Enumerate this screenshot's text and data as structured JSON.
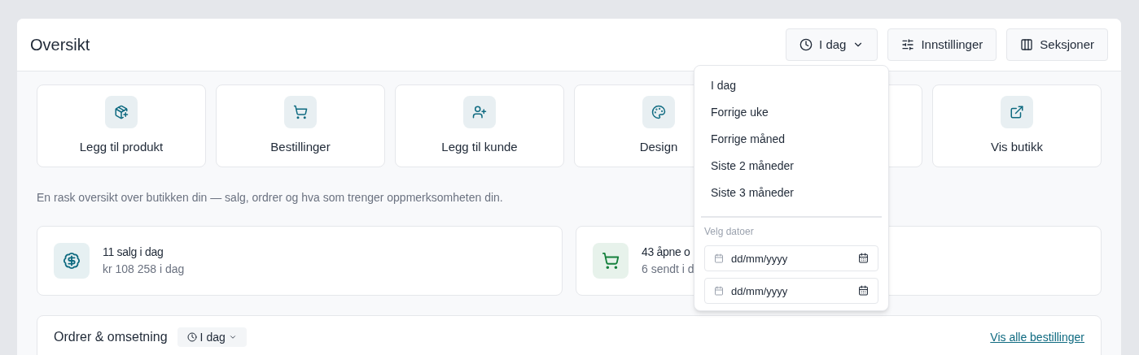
{
  "header": {
    "title": "Oversikt",
    "buttons": [
      {
        "kind": "period",
        "label": "I dag"
      },
      {
        "kind": "settings",
        "label": "Innstillinger"
      },
      {
        "kind": "sections",
        "label": "Seksjoner"
      }
    ]
  },
  "quick_actions": [
    {
      "kind": "product",
      "label": "Legg til produkt"
    },
    {
      "kind": "orders",
      "label": "Bestillinger"
    },
    {
      "kind": "customer",
      "label": "Legg til kunde"
    },
    {
      "kind": "design",
      "label": "Design"
    },
    {
      "kind": "covered"
    },
    {
      "kind": "store",
      "label": "Vis butikk"
    }
  ],
  "intro": "En rask oversikt over butikken din — salg, ordrer og hva som trenger oppmerksomheten din.",
  "stats": [
    {
      "kind": "sales",
      "color": "#0e6a80",
      "title": "11 salg i dag",
      "subtitle": "kr 108 258 i dag"
    },
    {
      "kind": "orders",
      "color": "#15803d",
      "title": "43 åpne o",
      "subtitle": "6 sendt i d"
    }
  ],
  "orders_panel": {
    "title": "Ordrer & omsetning",
    "period": "I dag",
    "link": "Vis alle bestillinger"
  },
  "period_menu": {
    "items": [
      "I dag",
      "Forrige uke",
      "Forrige måned",
      "Siste 2 måneder",
      "Siste 3 måneder"
    ],
    "date_label": "Velg datoer",
    "date_fields": [
      {
        "placeholder": "dd/mm/yyyy"
      },
      {
        "placeholder": "dd/mm/yyyy"
      }
    ]
  }
}
